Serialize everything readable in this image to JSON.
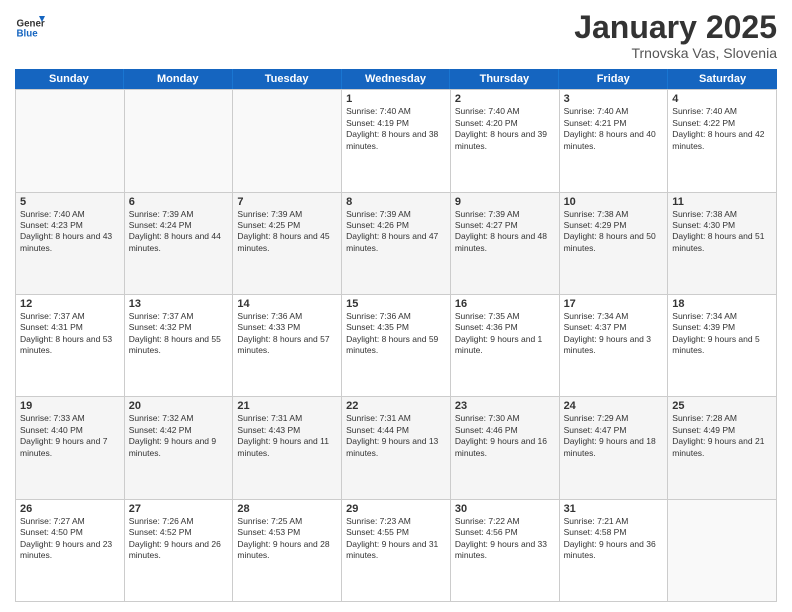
{
  "header": {
    "logo": {
      "general": "General",
      "blue": "Blue"
    },
    "title": "January 2025",
    "location": "Trnovska Vas, Slovenia"
  },
  "weekdays": [
    "Sunday",
    "Monday",
    "Tuesday",
    "Wednesday",
    "Thursday",
    "Friday",
    "Saturday"
  ],
  "weeks": [
    [
      {
        "day": "",
        "sunrise": "",
        "sunset": "",
        "daylight": "",
        "empty": true
      },
      {
        "day": "",
        "sunrise": "",
        "sunset": "",
        "daylight": "",
        "empty": true
      },
      {
        "day": "",
        "sunrise": "",
        "sunset": "",
        "daylight": "",
        "empty": true
      },
      {
        "day": "1",
        "sunrise": "Sunrise: 7:40 AM",
        "sunset": "Sunset: 4:19 PM",
        "daylight": "Daylight: 8 hours and 38 minutes.",
        "empty": false
      },
      {
        "day": "2",
        "sunrise": "Sunrise: 7:40 AM",
        "sunset": "Sunset: 4:20 PM",
        "daylight": "Daylight: 8 hours and 39 minutes.",
        "empty": false
      },
      {
        "day": "3",
        "sunrise": "Sunrise: 7:40 AM",
        "sunset": "Sunset: 4:21 PM",
        "daylight": "Daylight: 8 hours and 40 minutes.",
        "empty": false
      },
      {
        "day": "4",
        "sunrise": "Sunrise: 7:40 AM",
        "sunset": "Sunset: 4:22 PM",
        "daylight": "Daylight: 8 hours and 42 minutes.",
        "empty": false
      }
    ],
    [
      {
        "day": "5",
        "sunrise": "Sunrise: 7:40 AM",
        "sunset": "Sunset: 4:23 PM",
        "daylight": "Daylight: 8 hours and 43 minutes.",
        "empty": false
      },
      {
        "day": "6",
        "sunrise": "Sunrise: 7:39 AM",
        "sunset": "Sunset: 4:24 PM",
        "daylight": "Daylight: 8 hours and 44 minutes.",
        "empty": false
      },
      {
        "day": "7",
        "sunrise": "Sunrise: 7:39 AM",
        "sunset": "Sunset: 4:25 PM",
        "daylight": "Daylight: 8 hours and 45 minutes.",
        "empty": false
      },
      {
        "day": "8",
        "sunrise": "Sunrise: 7:39 AM",
        "sunset": "Sunset: 4:26 PM",
        "daylight": "Daylight: 8 hours and 47 minutes.",
        "empty": false
      },
      {
        "day": "9",
        "sunrise": "Sunrise: 7:39 AM",
        "sunset": "Sunset: 4:27 PM",
        "daylight": "Daylight: 8 hours and 48 minutes.",
        "empty": false
      },
      {
        "day": "10",
        "sunrise": "Sunrise: 7:38 AM",
        "sunset": "Sunset: 4:29 PM",
        "daylight": "Daylight: 8 hours and 50 minutes.",
        "empty": false
      },
      {
        "day": "11",
        "sunrise": "Sunrise: 7:38 AM",
        "sunset": "Sunset: 4:30 PM",
        "daylight": "Daylight: 8 hours and 51 minutes.",
        "empty": false
      }
    ],
    [
      {
        "day": "12",
        "sunrise": "Sunrise: 7:37 AM",
        "sunset": "Sunset: 4:31 PM",
        "daylight": "Daylight: 8 hours and 53 minutes.",
        "empty": false
      },
      {
        "day": "13",
        "sunrise": "Sunrise: 7:37 AM",
        "sunset": "Sunset: 4:32 PM",
        "daylight": "Daylight: 8 hours and 55 minutes.",
        "empty": false
      },
      {
        "day": "14",
        "sunrise": "Sunrise: 7:36 AM",
        "sunset": "Sunset: 4:33 PM",
        "daylight": "Daylight: 8 hours and 57 minutes.",
        "empty": false
      },
      {
        "day": "15",
        "sunrise": "Sunrise: 7:36 AM",
        "sunset": "Sunset: 4:35 PM",
        "daylight": "Daylight: 8 hours and 59 minutes.",
        "empty": false
      },
      {
        "day": "16",
        "sunrise": "Sunrise: 7:35 AM",
        "sunset": "Sunset: 4:36 PM",
        "daylight": "Daylight: 9 hours and 1 minute.",
        "empty": false
      },
      {
        "day": "17",
        "sunrise": "Sunrise: 7:34 AM",
        "sunset": "Sunset: 4:37 PM",
        "daylight": "Daylight: 9 hours and 3 minutes.",
        "empty": false
      },
      {
        "day": "18",
        "sunrise": "Sunrise: 7:34 AM",
        "sunset": "Sunset: 4:39 PM",
        "daylight": "Daylight: 9 hours and 5 minutes.",
        "empty": false
      }
    ],
    [
      {
        "day": "19",
        "sunrise": "Sunrise: 7:33 AM",
        "sunset": "Sunset: 4:40 PM",
        "daylight": "Daylight: 9 hours and 7 minutes.",
        "empty": false
      },
      {
        "day": "20",
        "sunrise": "Sunrise: 7:32 AM",
        "sunset": "Sunset: 4:42 PM",
        "daylight": "Daylight: 9 hours and 9 minutes.",
        "empty": false
      },
      {
        "day": "21",
        "sunrise": "Sunrise: 7:31 AM",
        "sunset": "Sunset: 4:43 PM",
        "daylight": "Daylight: 9 hours and 11 minutes.",
        "empty": false
      },
      {
        "day": "22",
        "sunrise": "Sunrise: 7:31 AM",
        "sunset": "Sunset: 4:44 PM",
        "daylight": "Daylight: 9 hours and 13 minutes.",
        "empty": false
      },
      {
        "day": "23",
        "sunrise": "Sunrise: 7:30 AM",
        "sunset": "Sunset: 4:46 PM",
        "daylight": "Daylight: 9 hours and 16 minutes.",
        "empty": false
      },
      {
        "day": "24",
        "sunrise": "Sunrise: 7:29 AM",
        "sunset": "Sunset: 4:47 PM",
        "daylight": "Daylight: 9 hours and 18 minutes.",
        "empty": false
      },
      {
        "day": "25",
        "sunrise": "Sunrise: 7:28 AM",
        "sunset": "Sunset: 4:49 PM",
        "daylight": "Daylight: 9 hours and 21 minutes.",
        "empty": false
      }
    ],
    [
      {
        "day": "26",
        "sunrise": "Sunrise: 7:27 AM",
        "sunset": "Sunset: 4:50 PM",
        "daylight": "Daylight: 9 hours and 23 minutes.",
        "empty": false
      },
      {
        "day": "27",
        "sunrise": "Sunrise: 7:26 AM",
        "sunset": "Sunset: 4:52 PM",
        "daylight": "Daylight: 9 hours and 26 minutes.",
        "empty": false
      },
      {
        "day": "28",
        "sunrise": "Sunrise: 7:25 AM",
        "sunset": "Sunset: 4:53 PM",
        "daylight": "Daylight: 9 hours and 28 minutes.",
        "empty": false
      },
      {
        "day": "29",
        "sunrise": "Sunrise: 7:23 AM",
        "sunset": "Sunset: 4:55 PM",
        "daylight": "Daylight: 9 hours and 31 minutes.",
        "empty": false
      },
      {
        "day": "30",
        "sunrise": "Sunrise: 7:22 AM",
        "sunset": "Sunset: 4:56 PM",
        "daylight": "Daylight: 9 hours and 33 minutes.",
        "empty": false
      },
      {
        "day": "31",
        "sunrise": "Sunrise: 7:21 AM",
        "sunset": "Sunset: 4:58 PM",
        "daylight": "Daylight: 9 hours and 36 minutes.",
        "empty": false
      },
      {
        "day": "",
        "sunrise": "",
        "sunset": "",
        "daylight": "",
        "empty": true
      }
    ]
  ]
}
